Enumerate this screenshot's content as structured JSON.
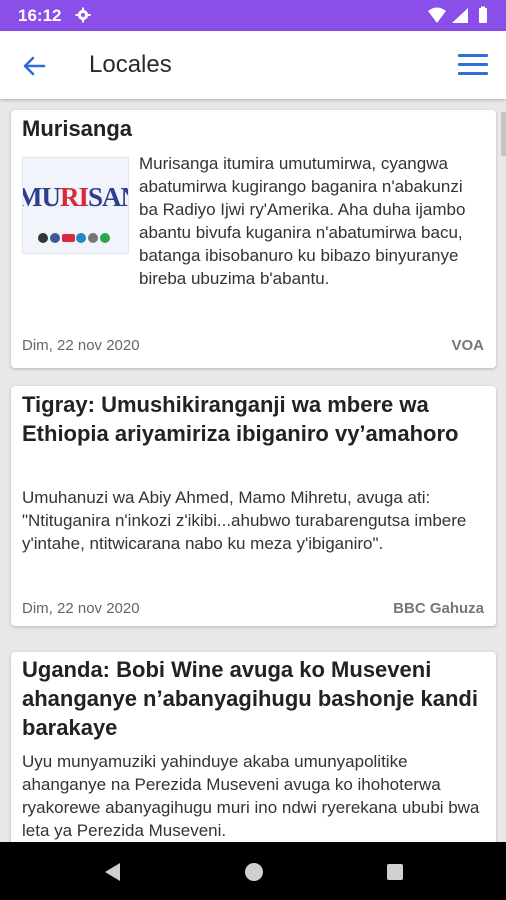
{
  "status": {
    "time": "16:12"
  },
  "header": {
    "title": "Locales"
  },
  "articles": [
    {
      "title": "Murisanga",
      "summary": "Murisanga itumira umutumirwa, cyangwa abatumirwa kugirango baganira n'abakunzi ba Radiyo Ijwi ry'Amerika. Aha duha ijambo abantu bivufa kuganira n'abatumirwa bacu, batanga ibisobanuro ku bibazo binyuranye bireba ubuzima b'abantu.",
      "date": "Dim, 22 nov 2020",
      "source": "VOA",
      "thumbnail_text": "MURISANGA"
    },
    {
      "title": "Tigray: Umushikiranganji wa mbere wa Ethiopia ariyamiriza ibiganiro vy’amahoro",
      "summary": "Umuhanuzi wa Abiy Ahmed, Mamo Mihretu, avuga ati: \"Ntituganira n'inkozi z'ikibi...ahubwo turabarengutsa imbere y'intahe, ntitwicarana nabo ku meza y'ibiganiro\".",
      "date": "Dim, 22 nov 2020",
      "source": "BBC Gahuza"
    },
    {
      "title": "Uganda: Bobi Wine avuga ko Museveni ahanganye n’abanyagihugu bashonje kandi barakaye",
      "summary": "Uyu munyamuziki yahinduye akaba umunyapolitike ahanganye na Perezida Museveni avuga ko ihohoterwa ryakorewe abanyagihugu muri ino ndwi ryerekana ububi bwa leta ya Perezida Museveni."
    }
  ],
  "colors": {
    "status_bar": "#8a4ee9",
    "accent": "#2f6fdb"
  }
}
